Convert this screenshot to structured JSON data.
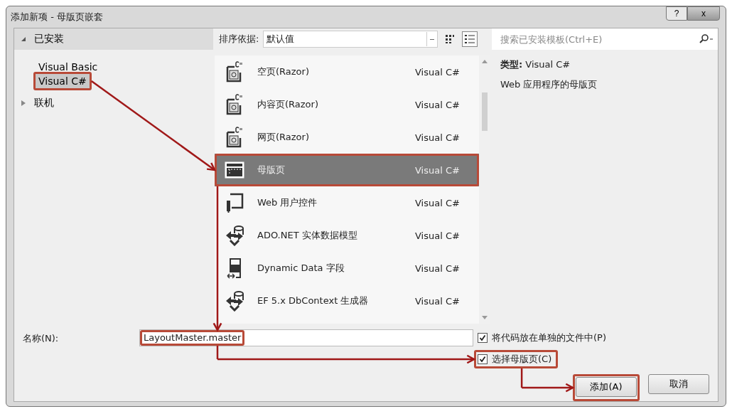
{
  "window": {
    "title": "添加新项 - 母版页嵌套",
    "help": "?",
    "close": "x"
  },
  "tree": [
    {
      "label": "已安装",
      "expanded": true,
      "selected": false,
      "children": [
        {
          "label": "Visual Basic",
          "selected": false
        },
        {
          "label": "Visual C#",
          "selected": true
        }
      ]
    },
    {
      "label": "联机",
      "expanded": false,
      "selected": false
    }
  ],
  "sort": {
    "label": "排序依据:",
    "value": "默认值"
  },
  "views": [
    {
      "kind": "grid",
      "selected": false
    },
    {
      "kind": "list",
      "selected": true
    }
  ],
  "templates": [
    {
      "name": "空页(Razor)",
      "language": "Visual C#",
      "kind": "razor",
      "selected": false
    },
    {
      "name": "内容页(Razor)",
      "language": "Visual C#",
      "kind": "razor",
      "selected": false
    },
    {
      "name": "网页(Razor)",
      "language": "Visual C#",
      "kind": "razor",
      "selected": false
    },
    {
      "name": "母版页",
      "language": "Visual C#",
      "kind": "master",
      "selected": true
    },
    {
      "name": "Web 用户控件",
      "language": "Visual C#",
      "kind": "control",
      "selected": false
    },
    {
      "name": "ADO.NET 实体数据模型",
      "language": "Visual C#",
      "kind": "data",
      "selected": false
    },
    {
      "name": "Dynamic Data 字段",
      "language": "Visual C#",
      "kind": "field",
      "selected": false
    },
    {
      "name": "EF 5.x DbContext 生成器",
      "language": "Visual C#",
      "kind": "data",
      "selected": false
    }
  ],
  "search": {
    "placeholder": "搜索已安装模板(Ctrl+E)"
  },
  "details": {
    "type": "**类型:**  Visual C#",
    "description": "Web 应用程序的母版页"
  },
  "name_field": {
    "label": "名称(N):",
    "value": "LayoutMaster.master"
  },
  "options": [
    {
      "label": "将代码放在单独的文件中(P)",
      "checked": true
    },
    {
      "label": "选择母版页(C)",
      "checked": true
    }
  ],
  "buttons": [
    "添加(A)",
    "取消"
  ]
}
